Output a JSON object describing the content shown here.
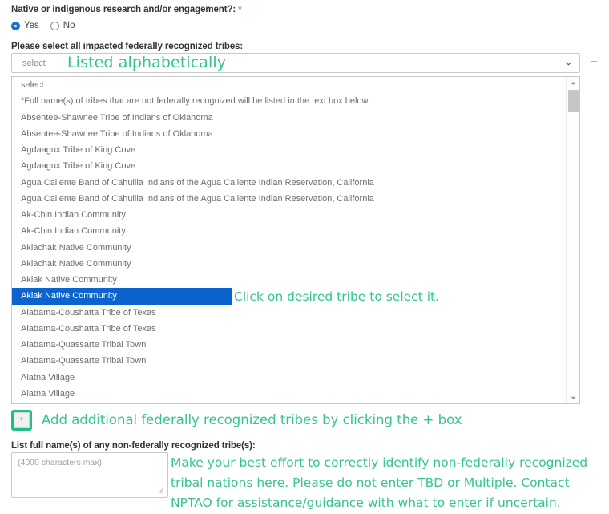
{
  "form": {
    "question_label": "Native or indigenous research and/or engagement?:",
    "required_marker": "*",
    "radio_options": [
      {
        "label": "Yes",
        "checked": true
      },
      {
        "label": "No",
        "checked": false
      }
    ],
    "tribes_label": "Please select all impacted federally recognized tribes:",
    "select_value": "select",
    "non_federal_label": "List full name(s) of any non-federally recognized tribe(s):",
    "textarea_placeholder": "(4000 characters max)",
    "textarea_value": "",
    "plus_button_label": "+"
  },
  "dropdown": {
    "selected_index": 13,
    "options": [
      "select",
      "*Full name(s) of tribes that are not federally recognized will be listed in the text box below",
      "Absentee-Shawnee Tribe of Indians of Oklahoma",
      "Absentee-Shawnee Tribe of Indians of Oklahoma",
      "Agdaagux Tribe of King Cove",
      "Agdaagux Tribe of King Cove",
      "Agua Caliente Band of Cahuilla Indians of the Agua Caliente Indian Reservation, California",
      "Agua Caliente Band of Cahuilla Indians of the Agua Caliente Indian Reservation, California",
      "Ak-Chin Indian Community",
      "Ak-Chin Indian Community",
      "Akiachak Native Community",
      "Akiachak Native Community",
      "Akiak Native Community",
      "Akiak Native Community",
      "Alabama-Coushatta Tribe of Texas",
      "Alabama-Coushatta Tribe of Texas",
      "Alabama-Quassarte Tribal Town",
      "Alabama-Quassarte Tribal Town",
      "Alatna Village",
      "Alatna Village"
    ]
  },
  "annotations": {
    "color": "#35c491",
    "alphabetical": "Listed alphabetically",
    "click_tribe": "Click on desired tribe to select it.",
    "add_more": "Add additional federally recognized tribes by clicking the + box",
    "non_federal_line1": "Make your best effort to correctly identify non-federally recognized",
    "non_federal_line2": "tribal nations here. Please do not enter TBD or Multiple. Contact",
    "non_federal_line3": "NPTAO for assistance/guidance with what to enter if uncertain."
  },
  "colors": {
    "accent_green": "#35c491",
    "selected_blue": "#0a63ce",
    "radio_blue": "#1a73d4",
    "required_star": "#d9796b"
  }
}
